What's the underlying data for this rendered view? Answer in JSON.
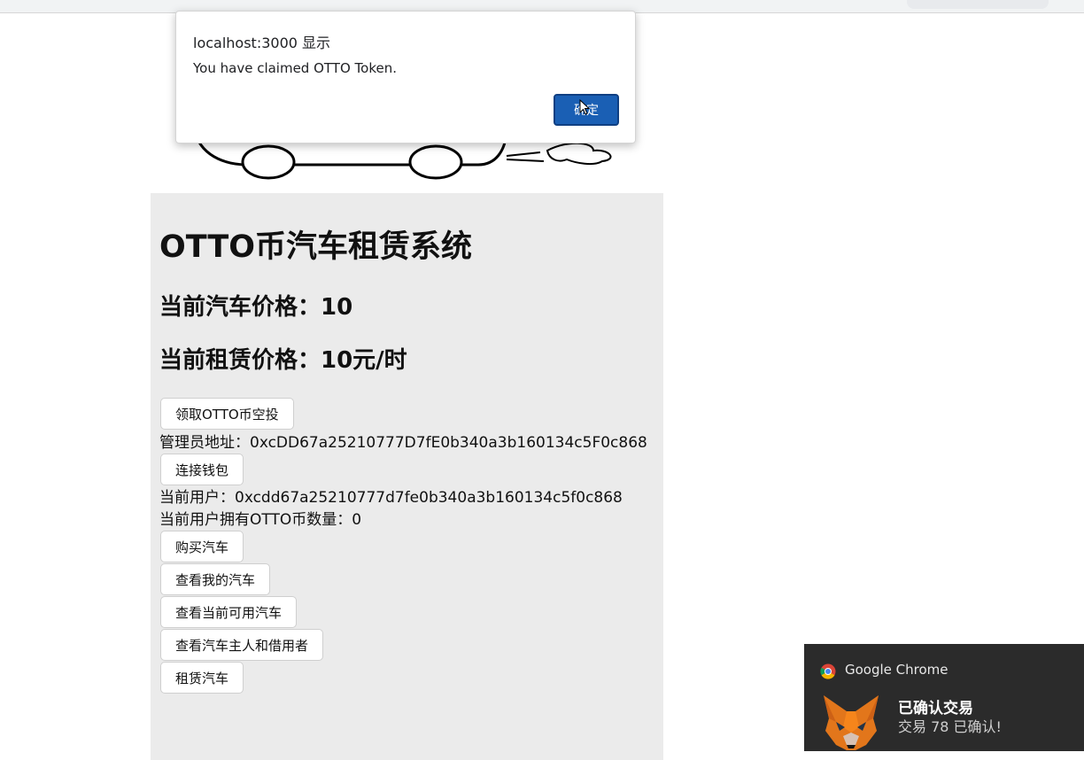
{
  "alert": {
    "title": "localhost:3000 显示",
    "message": "You have claimed OTTO Token.",
    "ok_label": "确定"
  },
  "app": {
    "title": "OTTO币汽车租赁系统",
    "car_price": "当前汽车价格：10",
    "rent_price": "当前租赁价格：10元/时",
    "claim_airdrop_label": "领取OTTO币空投",
    "admin_address": "管理员地址：0xcDD67a25210777D7fE0b340a3b160134c5F0c868",
    "connect_wallet_label": "连接钱包",
    "current_user": "当前用户：0xcdd67a25210777d7fe0b340a3b160134c5f0c868",
    "token_balance": "当前用户拥有OTTO币数量：0",
    "buy_car_label": "购买汽车",
    "view_my_cars_label": "查看我的汽车",
    "view_available_cars_label": "查看当前可用汽车",
    "view_owner_borrower_label": "查看汽车主人和借用者",
    "rent_car_label": "租赁汽车"
  },
  "notification": {
    "app_name": "Google Chrome",
    "heading": "已确认交易",
    "body": "交易 78 已确认!"
  },
  "colors": {
    "panel_bg": "#ebebeb",
    "alert_button": "#1a5fb4",
    "notification_bg": "#2b2b2b",
    "metamask_orange": "#e2761b"
  },
  "icons": {
    "notification_app": "chrome-icon",
    "notification_image": "metamask-fox-icon",
    "pointer": "mouse-cursor-icon"
  }
}
